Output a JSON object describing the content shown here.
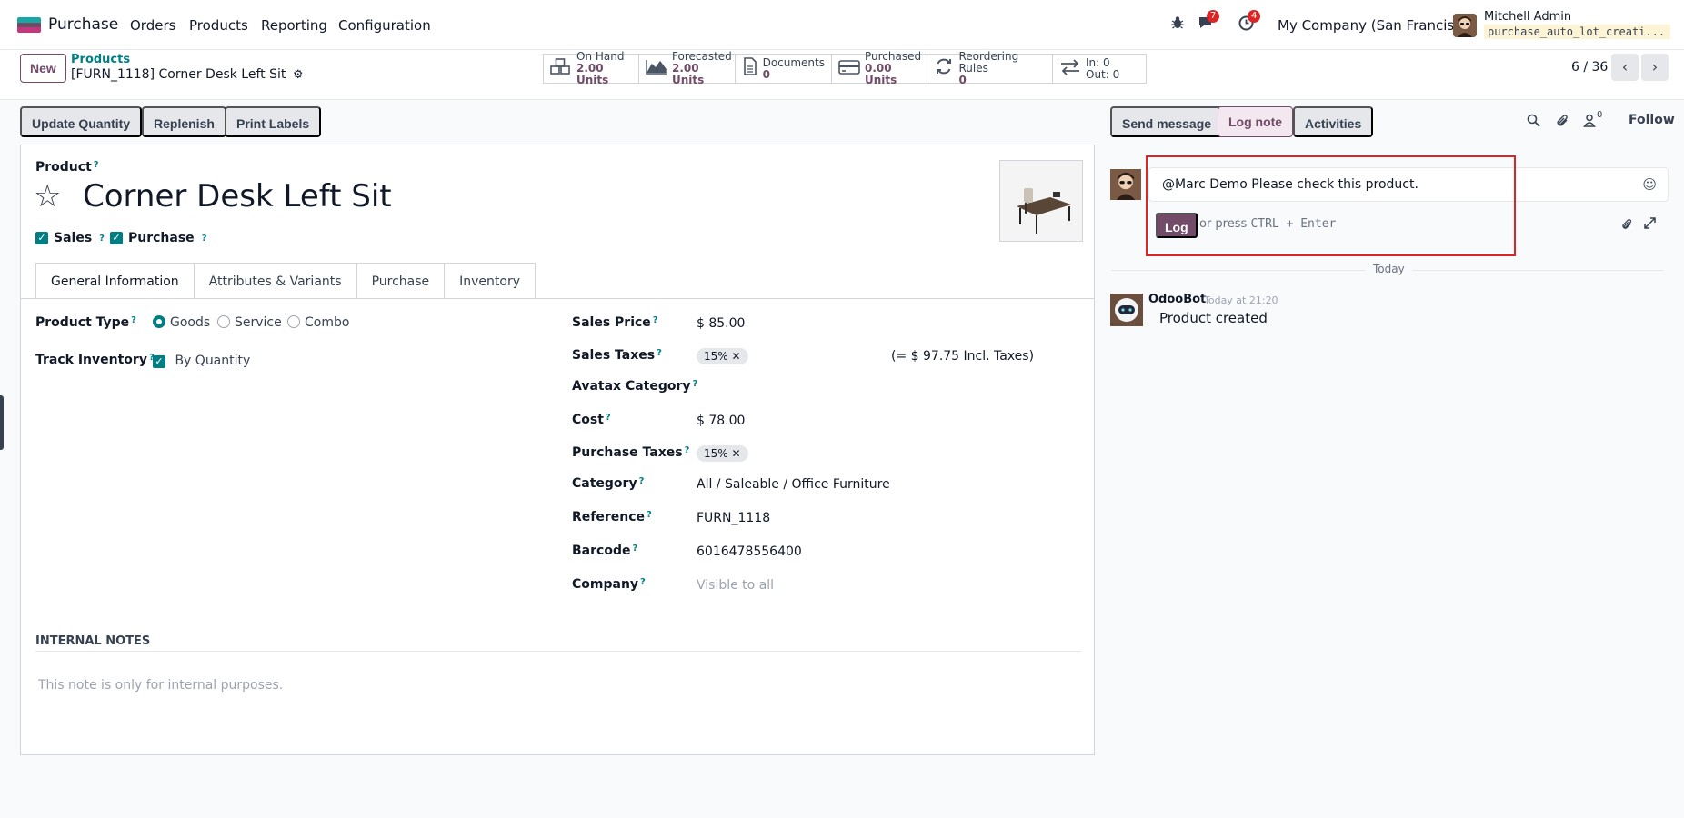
{
  "nav": {
    "app_name": "Purchase",
    "menu": [
      "Orders",
      "Products",
      "Reporting",
      "Configuration"
    ],
    "messages_count": "7",
    "activities_count": "4",
    "company": "My Company (San Francisco)",
    "user_name": "Mitchell Admin",
    "database": "purchase_auto_lot_creati..."
  },
  "control": {
    "new_label": "New",
    "breadcrumb_parent": "Products",
    "breadcrumb_current": "[FURN_1118] Corner Desk Left Sit",
    "smart_buttons": [
      {
        "label": "On Hand",
        "value": "2.00 Units",
        "icon": "cubes-icon"
      },
      {
        "label": "Forecasted",
        "value": "2.00 Units",
        "icon": "area-chart-icon"
      },
      {
        "label": "Documents",
        "value": "0",
        "icon": "file-icon"
      },
      {
        "label": "Purchased",
        "value": "0.00 Units",
        "icon": "credit-card-icon"
      },
      {
        "label": "Reordering Rules",
        "value": "0",
        "icon": "refresh-icon"
      },
      {
        "label": "In: 0",
        "value": "Out: 0",
        "icon": "exchange-icon"
      }
    ],
    "pager": "6 / 36"
  },
  "actions": [
    "Update Quantity",
    "Replenish",
    "Print Labels"
  ],
  "form": {
    "product_label": "Product",
    "product_name": "Corner Desk Left Sit",
    "sales_label": "Sales",
    "purchase_label": "Purchase",
    "tabs": [
      "General Information",
      "Attributes & Variants",
      "Purchase",
      "Inventory"
    ],
    "product_type_label": "Product Type",
    "product_type_options": [
      "Goods",
      "Service",
      "Combo"
    ],
    "product_type_selected": "Goods",
    "track_inventory_label": "Track Inventory",
    "track_inventory_value": "By Quantity",
    "sales_price_label": "Sales Price",
    "sales_price": "$ 85.00",
    "sales_taxes_label": "Sales Taxes",
    "sales_tax_tag": "15%",
    "incl_taxes": "(= $ 97.75 Incl. Taxes)",
    "avatax_label": "Avatax Category",
    "cost_label": "Cost",
    "cost": "$ 78.00",
    "purchase_taxes_label": "Purchase Taxes",
    "purchase_tax_tag": "15%",
    "category_label": "Category",
    "category": "All / Saleable / Office Furniture",
    "reference_label": "Reference",
    "reference": "FURN_1118",
    "barcode_label": "Barcode",
    "barcode": "6016478556400",
    "company_label": "Company",
    "company_placeholder": "Visible to all",
    "internal_notes_label": "INTERNAL NOTES",
    "internal_notes_placeholder": "This note is only for internal purposes."
  },
  "chatter": {
    "send_message": "Send message",
    "log_note": "Log note",
    "activities": "Activities",
    "followers_count": "0",
    "follow": "Follow",
    "composer_text": "@Marc Demo Please check this product.",
    "log_button": "Log",
    "hint_prefix": "or press",
    "hint_keys": "CTRL + Enter",
    "today": "Today",
    "author": "OdooBot",
    "time": "Today at 21:20",
    "message": "Product created"
  },
  "colors": {
    "brand": "#714b67",
    "teal": "#017e84",
    "highlight_box": "#dc2626"
  }
}
